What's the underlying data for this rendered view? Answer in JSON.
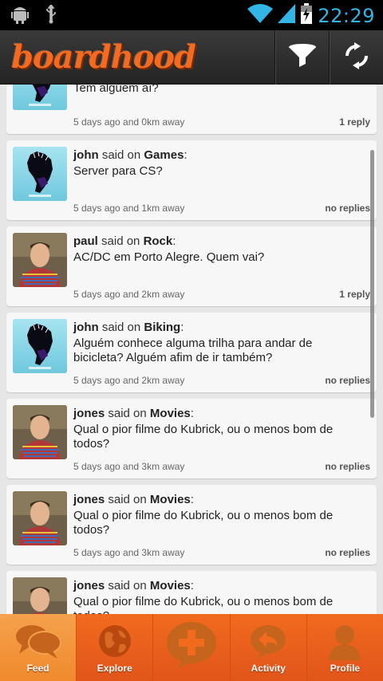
{
  "status_bar": {
    "time": "22:29",
    "icons": [
      "android-debug-icon",
      "usb-icon",
      "wifi-icon",
      "signal-icon",
      "battery-charging-icon"
    ]
  },
  "action_bar": {
    "logo_text": "boardhood",
    "filter_icon": "filter-funnel-icon",
    "refresh_icon": "refresh-icon"
  },
  "feed": {
    "said_on": "said on",
    "posts": [
      {
        "user": "",
        "board": "",
        "message": "Tem alguém aí?",
        "meta": "5 days ago and 0km away",
        "replies": "1 reply",
        "avatar": "map-avatar"
      },
      {
        "user": "john",
        "board": "Games",
        "message": "Server para CS?",
        "meta": "5 days ago and 1km away",
        "replies": "no replies",
        "avatar": "map-avatar"
      },
      {
        "user": "paul",
        "board": "Rock",
        "message": "AC/DC em Porto Alegre. Quem vai?",
        "meta": "5 days ago and 2km away",
        "replies": "1 reply",
        "avatar": "person-avatar"
      },
      {
        "user": "john",
        "board": "Biking",
        "message": "Alguém conhece alguma trilha para andar de bicicleta? Alguém afim de ir também?",
        "meta": "5 days ago and 2km away",
        "replies": "no replies",
        "avatar": "map-avatar"
      },
      {
        "user": "jones",
        "board": "Movies",
        "message": "Qual o pior filme do Kubrick, ou o menos bom de todos?",
        "meta": "5 days ago and 3km away",
        "replies": "no replies",
        "avatar": "person-avatar"
      },
      {
        "user": "jones",
        "board": "Movies",
        "message": "Qual o pior filme do Kubrick, ou o menos bom de todos?",
        "meta": "5 days ago and 3km away",
        "replies": "no replies",
        "avatar": "person-avatar"
      },
      {
        "user": "jones",
        "board": "Movies",
        "message": "Qual o pior filme do Kubrick, ou o menos bom de todos?",
        "meta": "",
        "replies": "",
        "avatar": "person-avatar"
      }
    ]
  },
  "bottom_nav": {
    "items": [
      {
        "label": "Feed",
        "icon": "chat-bubbles-icon",
        "active": true
      },
      {
        "label": "Explore",
        "icon": "globe-icon",
        "active": false
      },
      {
        "label": "",
        "icon": "new-post-plus-icon",
        "active": false
      },
      {
        "label": "Activity",
        "icon": "reply-arrow-icon",
        "active": false
      },
      {
        "label": "Profile",
        "icon": "user-silhouette-icon",
        "active": false
      }
    ]
  },
  "colors": {
    "brand_orange": "#f26b21",
    "status_time": "#33b5e5",
    "action_bar": "#2e2e2e",
    "card_bg": "#f7f7f7"
  }
}
